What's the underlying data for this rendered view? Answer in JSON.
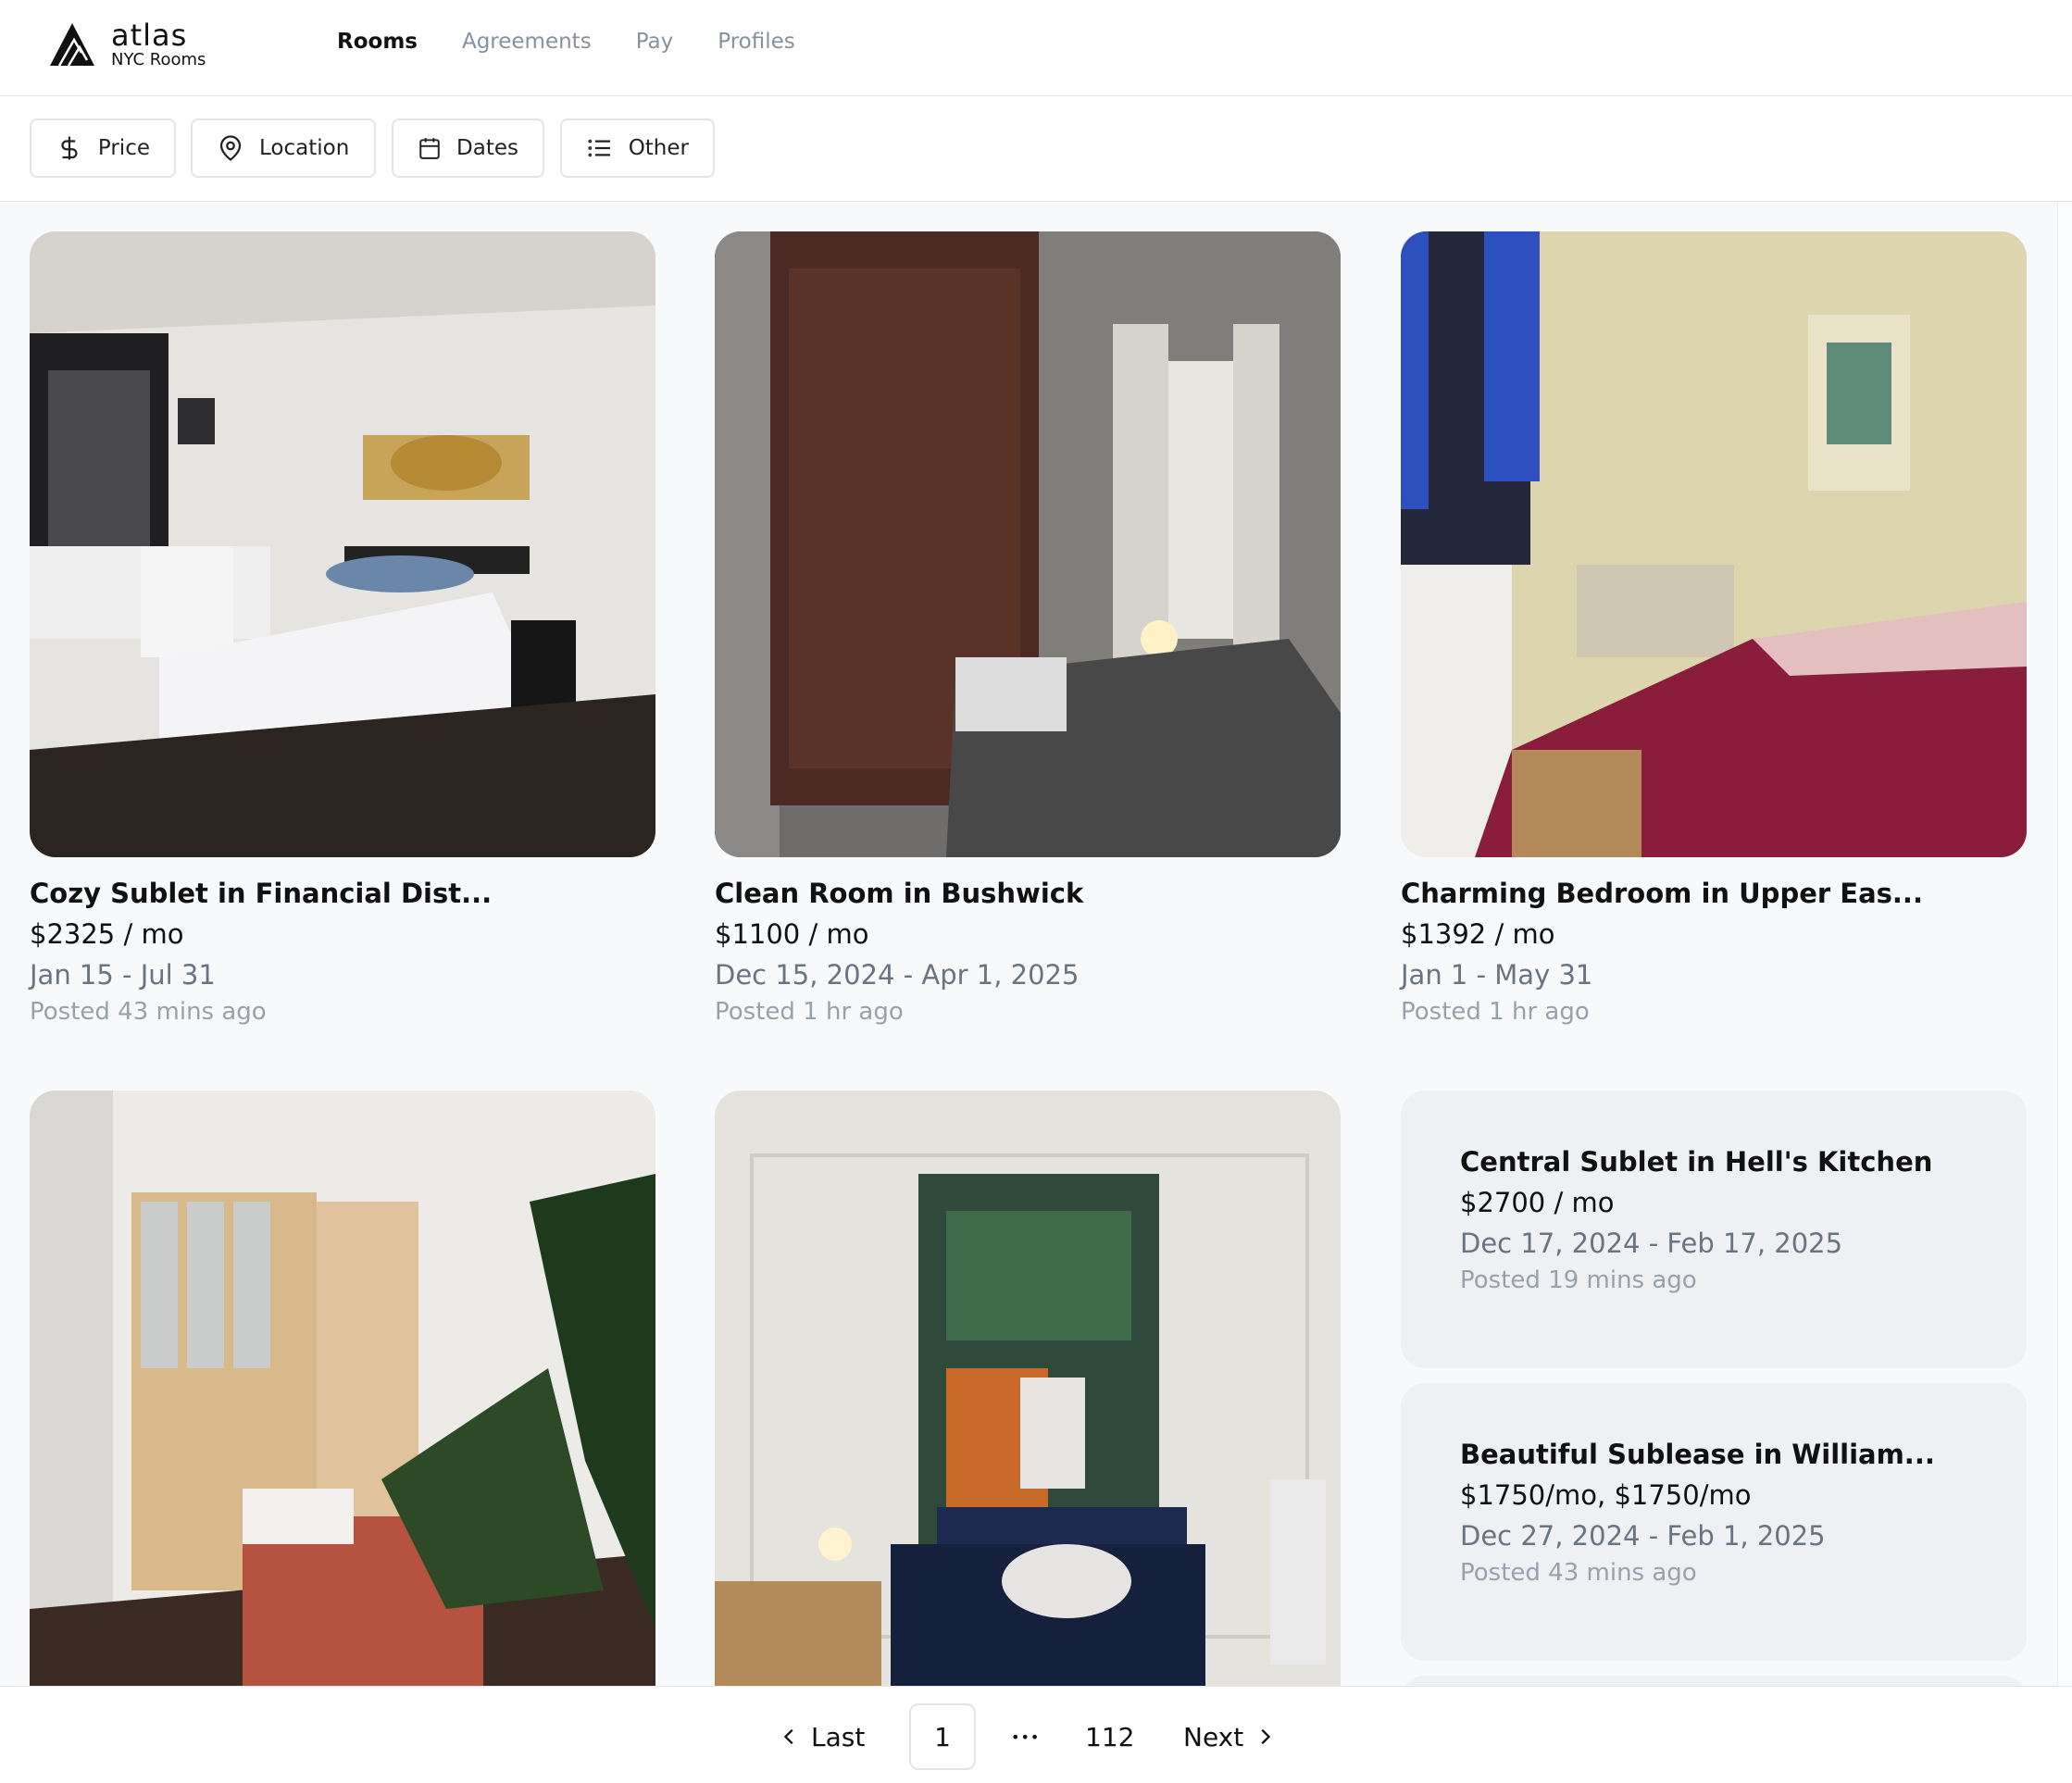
{
  "app": {
    "name": "atlas",
    "subtitle": "NYC Rooms"
  },
  "nav": {
    "items": [
      {
        "label": "Rooms",
        "active": true
      },
      {
        "label": "Agreements",
        "active": false
      },
      {
        "label": "Pay",
        "active": false
      },
      {
        "label": "Profiles",
        "active": false
      }
    ]
  },
  "filters": [
    {
      "label": "Price",
      "icon": "dollar-icon"
    },
    {
      "label": "Location",
      "icon": "map-pin-icon"
    },
    {
      "label": "Dates",
      "icon": "calendar-icon"
    },
    {
      "label": "Other",
      "icon": "list-icon"
    }
  ],
  "listings": [
    {
      "title": "Cozy Sublet in Financial Dist...",
      "price": "$2325 / mo",
      "dates": "Jan 15 - Jul 31",
      "posted": "Posted 43 mins ago"
    },
    {
      "title": "Clean Room in Bushwick",
      "price": "$1100 / mo",
      "dates": "Dec 15, 2024 - Apr 1, 2025",
      "posted": "Posted 1 hr ago"
    },
    {
      "title": "Charming Bedroom in Upper Eas...",
      "price": "$1392 / mo",
      "dates": "Jan 1 - May 31",
      "posted": "Posted 1 hr ago"
    },
    {
      "title": "",
      "price": "",
      "dates": "",
      "posted": ""
    },
    {
      "title": "",
      "price": "",
      "dates": "",
      "posted": ""
    },
    {
      "title": "Central Sublet in Hell's Kitchen",
      "price": "$2700 / mo",
      "dates": "Dec 17, 2024 - Feb 17, 2025",
      "posted": "Posted 19 mins ago"
    },
    {
      "title": "Beautiful Sublease in William...",
      "price": "$1750/mo, $1750/mo",
      "dates": "Dec 27, 2024 - Feb 1, 2025",
      "posted": "Posted 43 mins ago"
    }
  ],
  "pagination": {
    "prev_label": "Last",
    "current_page": "1",
    "ellipsis": "•••",
    "last_page": "112",
    "next_label": "Next"
  },
  "colors": {
    "background": "#f8f9fb",
    "text_card_bg": "#eef0f4",
    "muted_text": "#6b7280",
    "faint_text": "#9aa0aa"
  }
}
